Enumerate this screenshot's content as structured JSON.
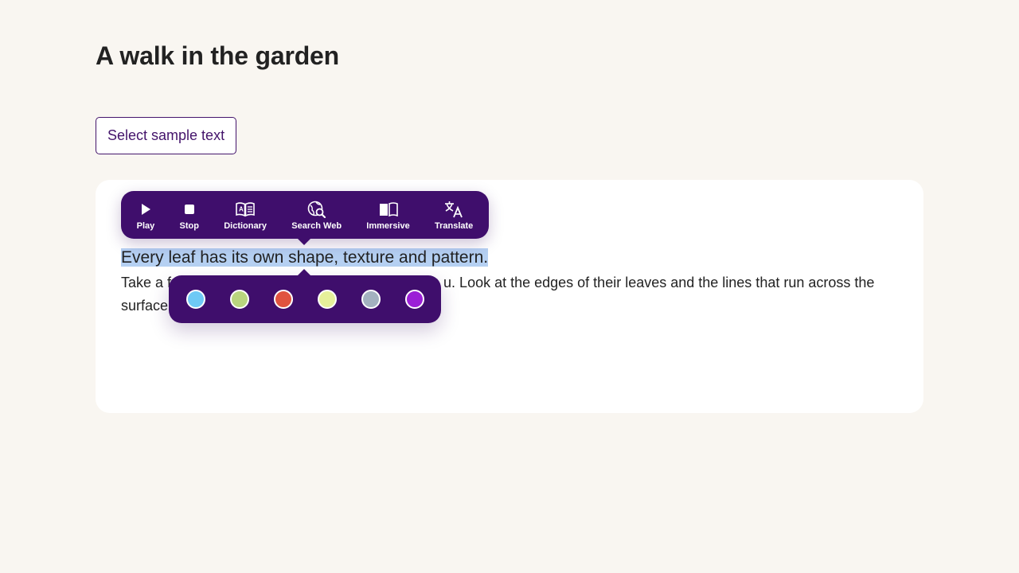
{
  "page": {
    "title": "A walk in the garden",
    "select_button_label": "Select sample text"
  },
  "content": {
    "selected_sentence": "Every leaf has its own shape, texture and pattern.",
    "paragraph_start": "Take a f",
    "paragraph_visible_middle": "u. Look at the edges of their leaves and the lines that run across the",
    "paragraph_second_line": "surface"
  },
  "toolbar": {
    "items": [
      {
        "label": "Play",
        "icon": "play-icon"
      },
      {
        "label": "Stop",
        "icon": "stop-icon"
      },
      {
        "label": "Dictionary",
        "icon": "dictionary-icon"
      },
      {
        "label": "Search Web",
        "icon": "search-web-icon"
      },
      {
        "label": "Immersive",
        "icon": "immersive-reader-icon"
      },
      {
        "label": "Translate",
        "icon": "translate-icon"
      }
    ]
  },
  "highlight_palette": {
    "colors": [
      {
        "name": "blue",
        "hex": "#6ec9f5"
      },
      {
        "name": "green",
        "hex": "#b9d47e"
      },
      {
        "name": "red",
        "hex": "#e0533f"
      },
      {
        "name": "yellow",
        "hex": "#e6f09a"
      },
      {
        "name": "gray",
        "hex": "#a3b1bf"
      },
      {
        "name": "purple",
        "hex": "#9b1fd6"
      }
    ]
  },
  "colors": {
    "accent": "#3f0e6c",
    "selection": "#b5d0f2",
    "background": "#f9f6f1"
  }
}
